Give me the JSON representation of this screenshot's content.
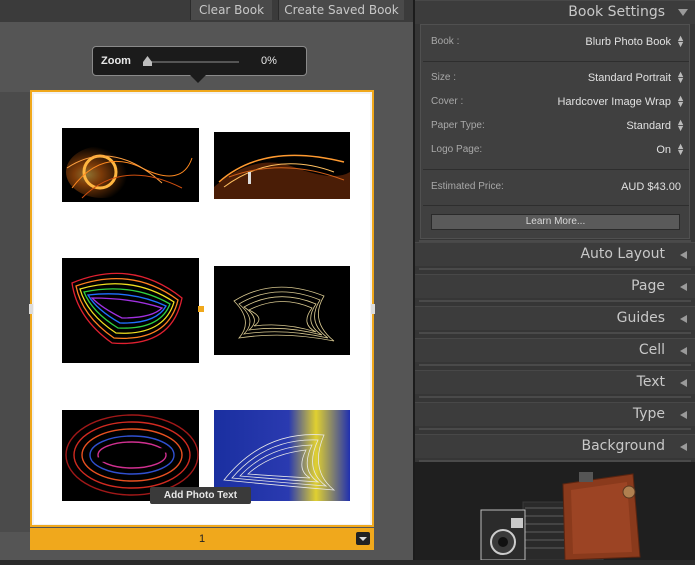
{
  "toolbar": {
    "clear_book": "Clear Book",
    "create_saved_book": "Create Saved Book"
  },
  "zoom": {
    "label": "Zoom",
    "value": "0%",
    "level": 0
  },
  "page": {
    "add_photo_text": "Add Photo Text",
    "page_number": "1"
  },
  "book_settings": {
    "title": "Book Settings",
    "book_label": "Book :",
    "book_value": "Blurb Photo Book",
    "size_label": "Size :",
    "size_value": "Standard Portrait",
    "cover_label": "Cover :",
    "cover_value": "Hardcover Image Wrap",
    "paper_type_label": "Paper Type:",
    "paper_type_value": "Standard",
    "logo_page_label": "Logo Page:",
    "logo_page_value": "On",
    "price_label": "Estimated Price:",
    "price_value": "AUD $43.00",
    "learn_more": "Learn More..."
  },
  "panels": [
    "Auto Layout",
    "Page",
    "Guides",
    "Cell",
    "Text",
    "Type",
    "Background"
  ],
  "colors": {
    "accent": "#f0a81c",
    "panel_bg": "#363636",
    "canvas_bg": "#555555"
  }
}
